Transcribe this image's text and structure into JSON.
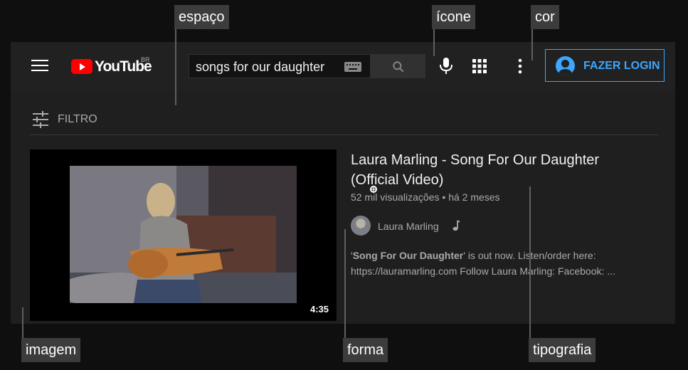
{
  "header": {
    "logo_text": "YouTube",
    "region": "BR",
    "search": {
      "value": "songs for our daughter"
    },
    "login_label": "FAZER LOGIN"
  },
  "filter": {
    "label": "FILTRO"
  },
  "result": {
    "duration": "4:35",
    "title": "Laura Marling - Song For Our Daughter (Official Video)",
    "views": "52 mil visualizações",
    "separator": "•",
    "age": "há 2 meses",
    "channel": "Laura Marling",
    "description_bold": "Song For Our Daughter",
    "description_rest": "' is out now. Listen/order here: https://lauramarling.com Follow Laura Marling: Facebook: ...",
    "description_open": "'"
  },
  "annotations": {
    "espaco": "espaço",
    "icone": "ícone",
    "cor": "cor",
    "imagem": "imagem",
    "forma": "forma",
    "tipografia": "tipografia"
  },
  "colors": {
    "brand_red": "#ff0000",
    "login_blue": "#3ea6ff",
    "panel": "#1f1f1f",
    "tag_bg": "#3c3c3c"
  },
  "icons": [
    "menu-icon",
    "youtube-logo",
    "keyboard-icon",
    "search-icon",
    "mic-icon",
    "apps-icon",
    "more-vert-icon",
    "account-icon",
    "filter-icon",
    "music-note-icon"
  ]
}
